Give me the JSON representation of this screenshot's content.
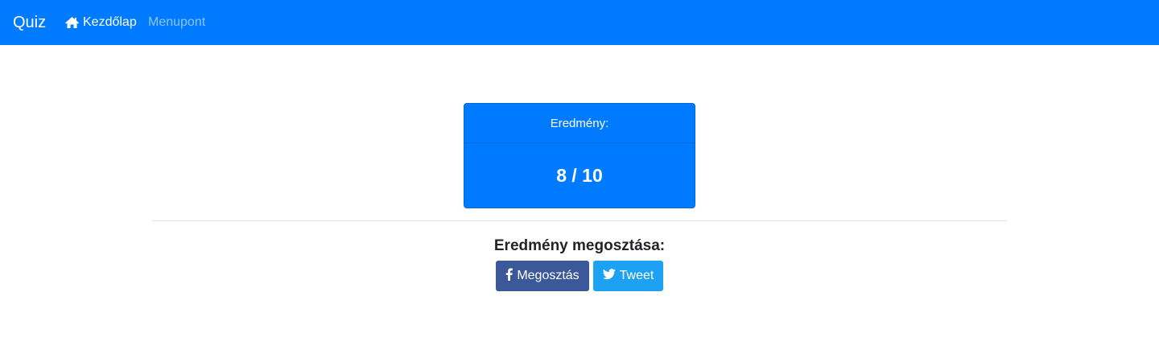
{
  "navbar": {
    "brand": "Quiz",
    "items": [
      {
        "label": "Kezdőlap",
        "icon": "home-icon",
        "active": true
      },
      {
        "label": "Menupont",
        "active": false
      }
    ],
    "background": "#007bff"
  },
  "result": {
    "header": "Eredmény:",
    "score": "8 / 10",
    "background": "#007bff"
  },
  "share": {
    "title": "Eredmény megosztása:",
    "facebook": {
      "label": "Megosztás",
      "icon": "facebook-icon",
      "color": "#3b5998"
    },
    "twitter": {
      "label": "Tweet",
      "icon": "twitter-icon",
      "color": "#1da1f2"
    }
  }
}
